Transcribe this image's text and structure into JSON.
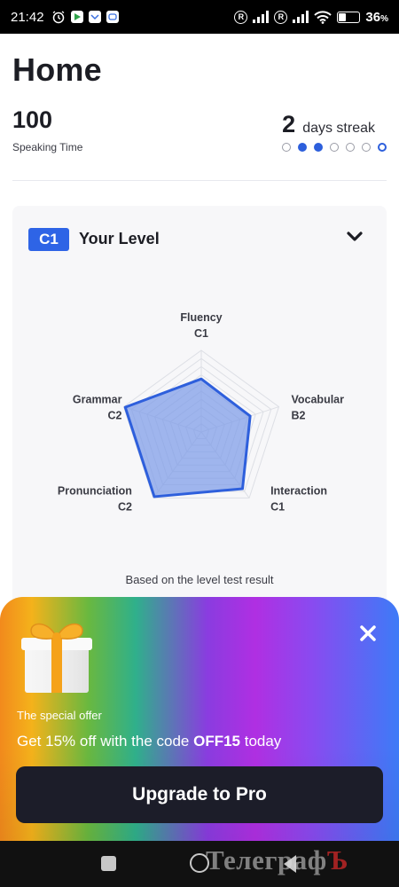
{
  "status_bar": {
    "time": "21:42",
    "battery_percent": "36",
    "battery_unit": "%"
  },
  "header": {
    "title": "Home",
    "speaking_time_value": "100",
    "speaking_time_label": "Speaking Time",
    "streak_count": "2",
    "streak_label": "days streak",
    "streak_dots": [
      "empty",
      "filled",
      "filled",
      "empty",
      "empty",
      "empty",
      "ring"
    ]
  },
  "level_card": {
    "badge": "C1",
    "title": "Your Level",
    "note": "Based on the level test result",
    "skills": [
      {
        "name": "Fluency",
        "level": "C1",
        "score": 0.65
      },
      {
        "name": "Vocabular",
        "level": "B2",
        "score": 0.63
      },
      {
        "name": "Interaction",
        "level": "C1",
        "score": 0.86
      },
      {
        "name": "Pronunciation",
        "level": "C2",
        "score": 0.98
      },
      {
        "name": "Grammar",
        "level": "C2",
        "score": 0.98
      }
    ]
  },
  "promo": {
    "label": "The special offer",
    "text_prefix": "Get 15% off with the code ",
    "code": "OFF15",
    "text_suffix": " today",
    "button": "Upgrade to Pro"
  },
  "watermark": {
    "text": "Телеграф",
    "last_letter": "Ъ"
  },
  "colors": {
    "accent": "#2e64e6",
    "button_dark": "#1c1d29",
    "radar_fill": "#7d9be8",
    "radar_stroke": "#2e5fdc"
  }
}
